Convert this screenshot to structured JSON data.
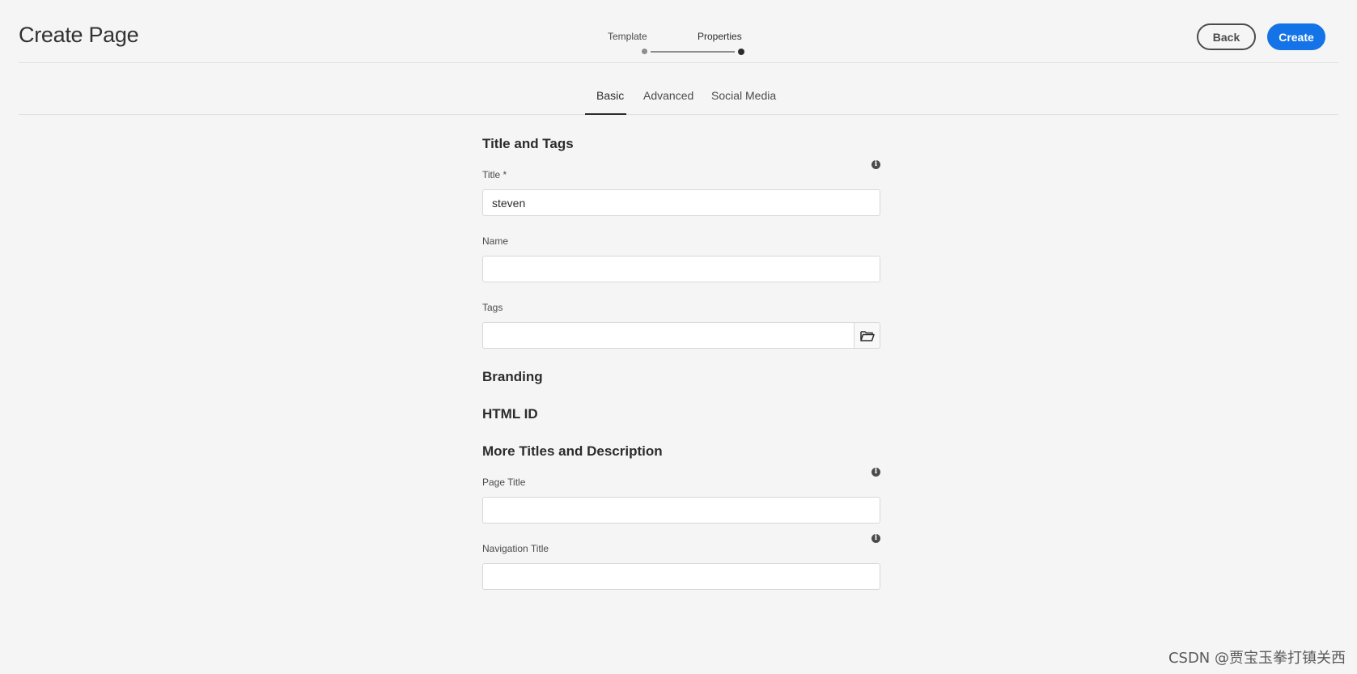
{
  "header": {
    "title": "Create Page",
    "steps": [
      {
        "label": "Template",
        "state": "completed"
      },
      {
        "label": "Properties",
        "state": "current"
      }
    ],
    "back_label": "Back",
    "create_label": "Create"
  },
  "tabs": [
    {
      "label": "Basic",
      "active": true
    },
    {
      "label": "Advanced",
      "active": false
    },
    {
      "label": "Social Media",
      "active": false
    }
  ],
  "form": {
    "title_and_tags": {
      "heading": "Title and Tags",
      "title_label": "Title *",
      "title_value": "steven",
      "name_label": "Name",
      "name_value": "",
      "tags_label": "Tags",
      "tags_value": ""
    },
    "branding_heading": "Branding",
    "html_id_heading": "HTML ID",
    "more_titles": {
      "heading": "More Titles and Description",
      "page_title_label": "Page Title",
      "page_title_value": "",
      "navigation_title_label": "Navigation Title",
      "navigation_title_value": ""
    }
  },
  "icons": {
    "info": "info-icon",
    "tags_picker": "folder-open-icon"
  },
  "colors": {
    "accent": "#1473e6",
    "background": "#f5f5f5",
    "text": "#2c2c2c"
  },
  "watermark": "CSDN @贾宝玉拳打镇关西"
}
